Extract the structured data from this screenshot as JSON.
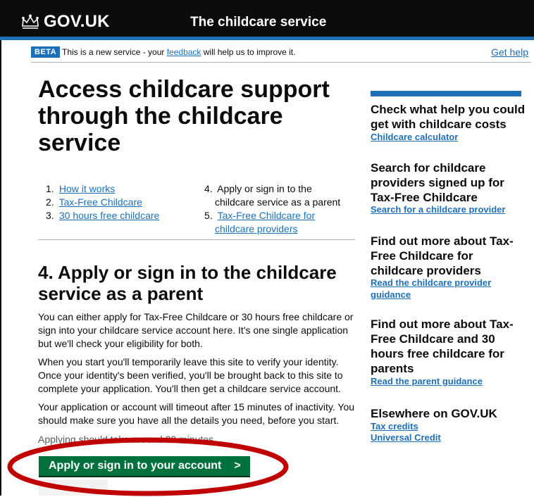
{
  "header": {
    "logo_text": "GOV.UK",
    "service_name": "The childcare service",
    "colors": {
      "background": "#0b0c0c",
      "strip": "#1d70b8"
    },
    "crown_icon": "crown-icon"
  },
  "phase_banner": {
    "tag": "BETA",
    "text_before": "This is a new service - your ",
    "feedback_link": "feedback",
    "text_after": " will help us to improve it.",
    "help_link": "Get help"
  },
  "main": {
    "title": "Access childcare support through the childcare service",
    "contents_left": [
      {
        "num": "1.",
        "label": "How it works"
      },
      {
        "num": "2.",
        "label": "Tax-Free Childcare"
      },
      {
        "num": "3.",
        "label": "30 hours free childcare"
      }
    ],
    "contents_right": [
      {
        "num": "4.",
        "line1": "Apply or sign in to the",
        "line2": "childcare service as a parent"
      },
      {
        "num": "5.",
        "line1": "Tax-Free Childcare for",
        "line2": "childcare providers"
      }
    ],
    "section_heading": "4. Apply or sign in to the childcare service as a parent",
    "paragraphs": [
      "You can either apply for Tax-Free Childcare or 30 hours free childcare or sign into your childcare service account here. It's one single application but we'll check your eligibility for both.",
      "When you start you'll temporarily leave this site to verify your identity. Once your identity's been verified, you'll be brought back to this site to complete your application. You'll then get a childcare service account.",
      "Your application or account will timeout after 15 minutes of inactivity. You should make sure you have all the details you need, before you start.",
      "Applying should take around 20 minutes."
    ],
    "start_button": {
      "label": "Apply or sign in to your account",
      "chevron": ">",
      "color": "#00703c"
    },
    "highlight_color": "#c00000"
  },
  "sidebar": {
    "accent_color": "#1d70b8",
    "sections": [
      {
        "heading": "Check what help you could get with childcare costs",
        "links": [
          "Childcare calculator"
        ]
      },
      {
        "heading": "Search for childcare providers signed up for Tax-Free Childcare",
        "links": [
          "Search for a childcare provider"
        ]
      },
      {
        "heading": "Find out more about Tax-Free Childcare for childcare providers",
        "links": [
          "Read the childcare provider guidance"
        ]
      },
      {
        "heading": "Find out more about Tax-Free Childcare and 30 hours free childcare for parents",
        "links": [
          "Read the parent guidance"
        ]
      },
      {
        "heading": "Elsewhere on GOV.UK",
        "links": [
          "Tax credits",
          "Universal Credit"
        ]
      }
    ]
  }
}
